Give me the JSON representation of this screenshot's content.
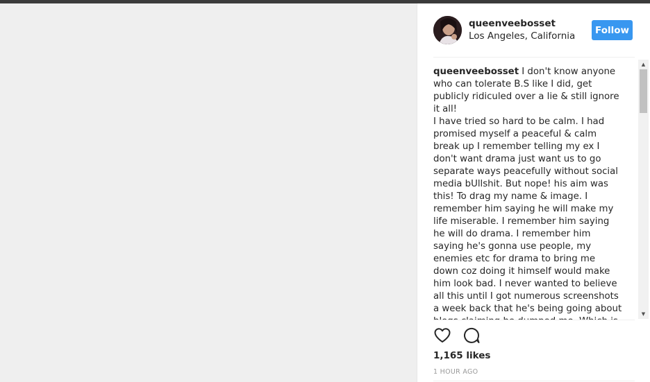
{
  "post": {
    "username": "queenveebosset",
    "location": "Los Angeles, California",
    "follow_label": "Follow",
    "likes": "1,165 likes",
    "time": "1 HOUR AGO"
  },
  "caption": {
    "username": "queenveebosset",
    "text": " I don't know anyone who can tolerate B.S like I did, get publicly ridiculed over a lie & still ignore it all!\nI have tried so hard to be calm. I had promised myself a peaceful & calm break up I remember telling my ex I don't want drama just want us to go separate ways peacefully without social media bUllshit. But nope! his aim was this! To drag my name & image. I remember him saying he will make my life miserable. I remember him saying he will do drama. I remember him saying he's gonna use people, my enemies etc for drama to bring me down coz doing it himself would make him look bad. I never wanted to believe all this until I got numerous screenshots a week back that he's being going about blogs claiming he dumped me. Which is a lie. I ended the relationship. But that doesn't matter, that's why this anybody can ask me to say the"
  },
  "icons": {
    "like": "heart-icon",
    "comment": "comment-icon",
    "scroll_up": "arrow-up-icon",
    "scroll_down": "arrow-down-icon"
  },
  "colors": {
    "follow_button": "#3897f0",
    "text": "#262626",
    "muted": "#999999"
  }
}
